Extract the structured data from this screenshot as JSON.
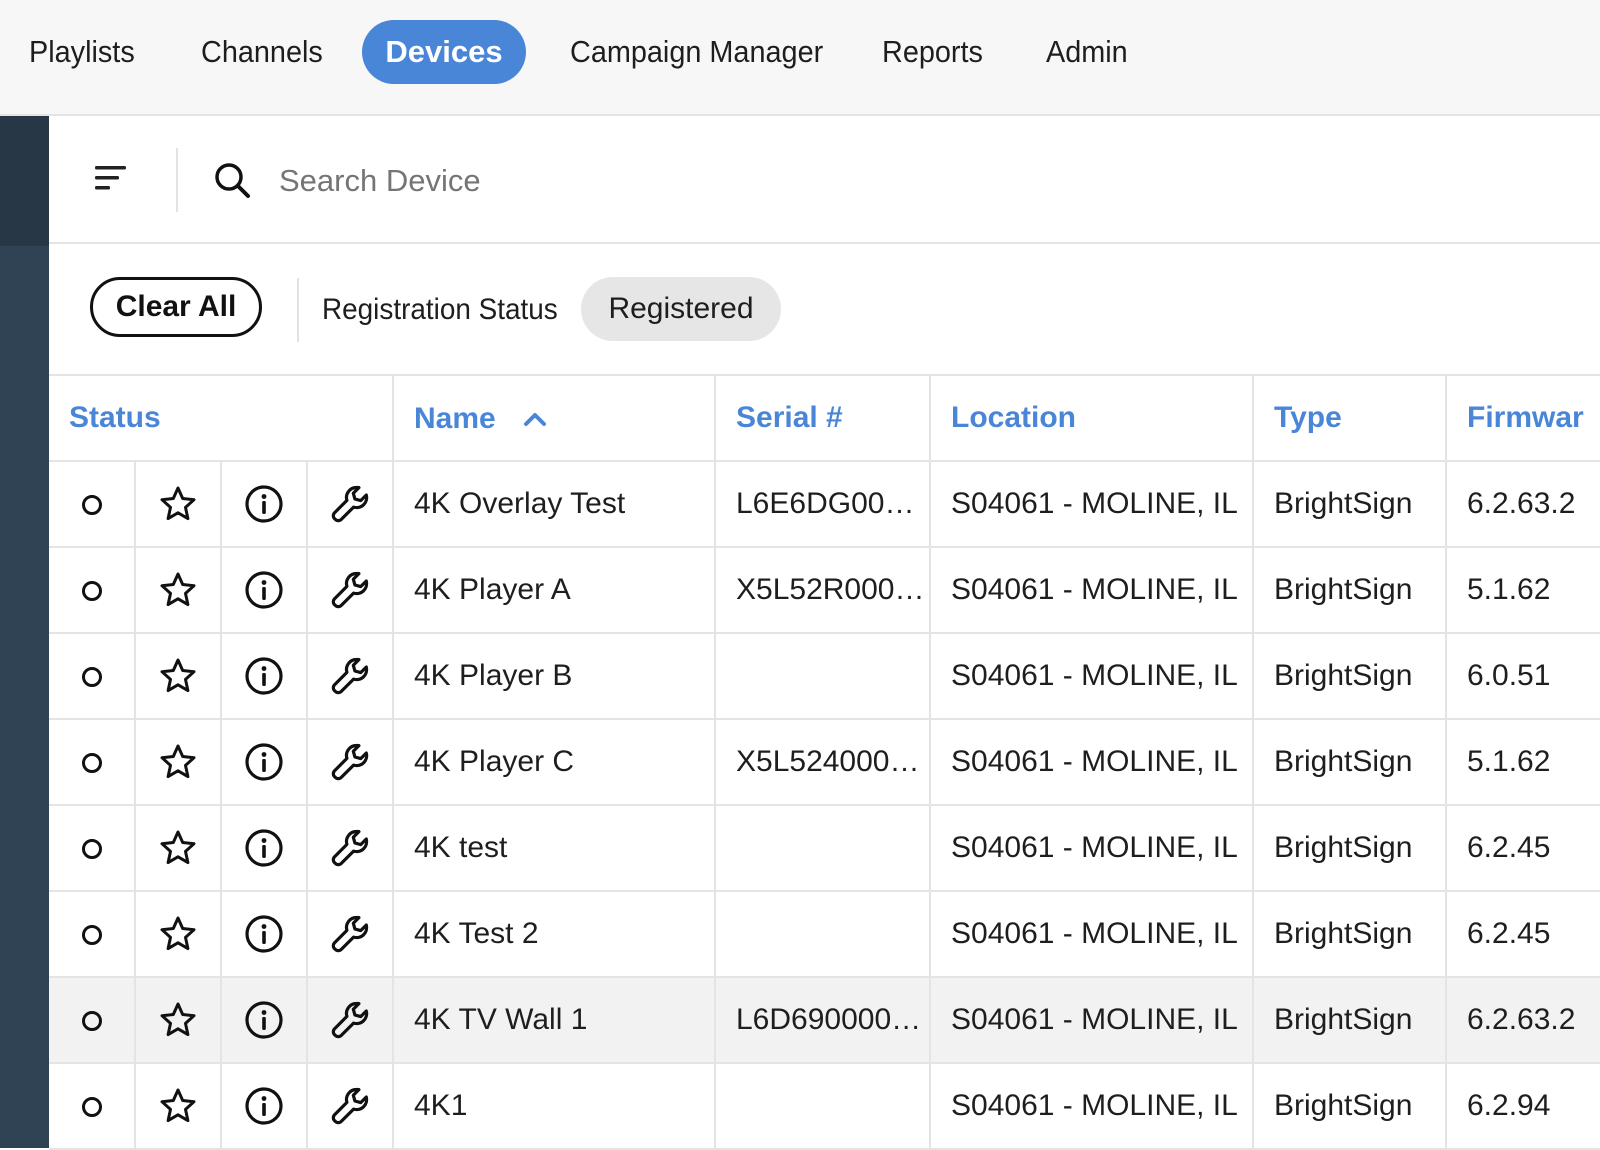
{
  "nav": {
    "tabs": [
      {
        "label": "Playlists"
      },
      {
        "label": "Channels"
      },
      {
        "label": "Devices",
        "active": true
      },
      {
        "label": "Campaign Manager"
      },
      {
        "label": "Reports"
      },
      {
        "label": "Admin"
      }
    ]
  },
  "search": {
    "placeholder": "Search Device",
    "value": ""
  },
  "filters": {
    "clear_label": "Clear All",
    "group_label": "Registration Status",
    "chip_label": "Registered"
  },
  "table": {
    "headers": {
      "status": "Status",
      "name": "Name",
      "serial": "Serial #",
      "location": "Location",
      "type": "Type",
      "firmware": "Firmwar"
    },
    "sort": {
      "column": "name",
      "direction": "ascending",
      "icon": "chevron-up-icon"
    },
    "rows": [
      {
        "name": "4K Overlay Test",
        "serial": "L6E6DG001…",
        "location": "S04061 - MOLINE, IL",
        "type": "BrightSign",
        "firmware": "6.2.63.2"
      },
      {
        "name": "4K Player A",
        "serial": "X5L52R000…",
        "location": "S04061 - MOLINE, IL",
        "type": "BrightSign",
        "firmware": "5.1.62"
      },
      {
        "name": "4K Player B",
        "serial": "",
        "location": "S04061 - MOLINE, IL",
        "type": "BrightSign",
        "firmware": "6.0.51"
      },
      {
        "name": "4K Player C",
        "serial": "X5L524000…",
        "location": "S04061 - MOLINE, IL",
        "type": "BrightSign",
        "firmware": "5.1.62"
      },
      {
        "name": "4K test",
        "serial": "",
        "location": "S04061 - MOLINE, IL",
        "type": "BrightSign",
        "firmware": "6.2.45"
      },
      {
        "name": "4K Test 2",
        "serial": "",
        "location": "S04061 - MOLINE, IL",
        "type": "BrightSign",
        "firmware": "6.2.45"
      },
      {
        "name": "4K TV Wall 1",
        "serial": "L6D690000…",
        "location": "S04061 - MOLINE, IL",
        "type": "BrightSign",
        "firmware": "6.2.63.2",
        "highlighted": true
      },
      {
        "name": "4K1",
        "serial": "",
        "location": "S04061 - MOLINE, IL",
        "type": "BrightSign",
        "firmware": "6.2.94"
      }
    ],
    "row_icons": [
      "status-circle-icon",
      "star-icon",
      "info-icon",
      "wrench-icon"
    ]
  },
  "colors": {
    "accent": "#4a86d8",
    "sidebar": "#2f4354",
    "nav_bg": "#f7f7f7",
    "chip_bg": "#e6e6e6",
    "highlight_row": "#f2f2f2"
  }
}
